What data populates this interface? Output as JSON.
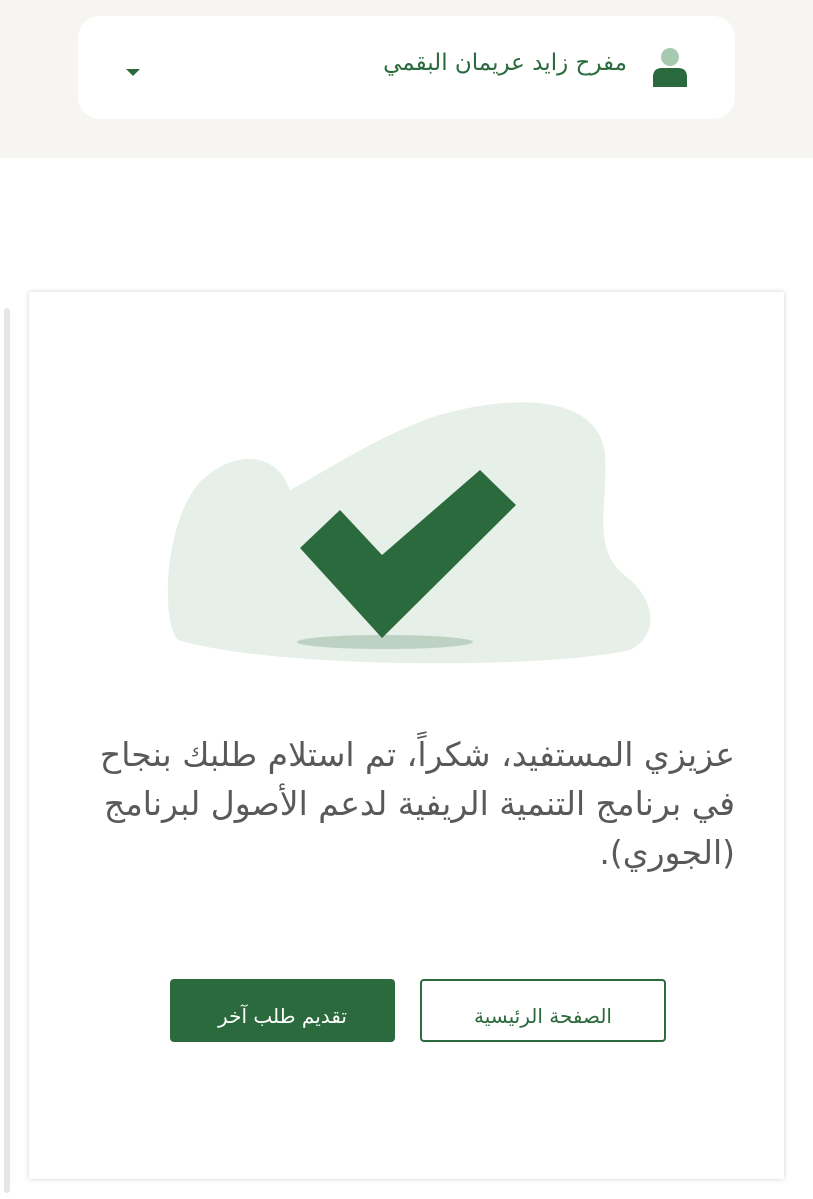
{
  "header": {
    "user_name": "مفرح زايد عريمان البقمي",
    "user_icon": "user-avatar-icon",
    "menu_icon": "caret-down-icon"
  },
  "confirmation": {
    "icon": "checkmark-icon",
    "message": "عزيزي المستفيد، شكراً، تم استلام طلبك بنجاح في برنامج التنمية الريفية لدعم الأصول لبرنامج (الجوري)."
  },
  "actions": {
    "new_request_label": "تقديم طلب آخر",
    "home_label": "الصفحة الرئيسية"
  },
  "colors": {
    "brand": "#2b6a3d",
    "header_bg": "#f6f5f1",
    "blob": "#e6efe8",
    "text": "#595959"
  }
}
